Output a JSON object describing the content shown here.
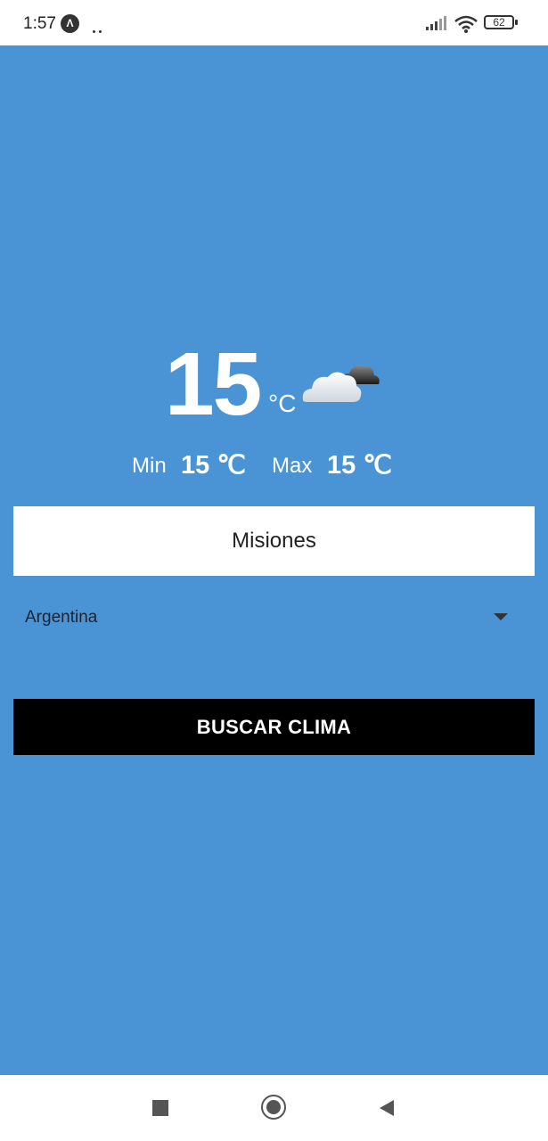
{
  "status_bar": {
    "time": "1:57",
    "app_badge": "Λ",
    "battery": "62",
    "icons": [
      "signal-icon",
      "wifi-icon",
      "battery-icon"
    ]
  },
  "weather": {
    "temperature": "15",
    "temperature_unit": "°C",
    "condition_icon": "cloudy-icon",
    "min_label": "Min",
    "min_value": "15 ℃",
    "max_label": "Max",
    "max_value": "15 ℃"
  },
  "form": {
    "city_value": "Misiones",
    "country_selected": "Argentina",
    "search_button_label": "BUSCAR CLIMA"
  },
  "nav_bar": {
    "icons": [
      "recent-apps-icon",
      "home-icon",
      "back-icon"
    ]
  },
  "colors": {
    "background": "#4a94d6",
    "button": "#000000",
    "input": "#ffffff"
  }
}
